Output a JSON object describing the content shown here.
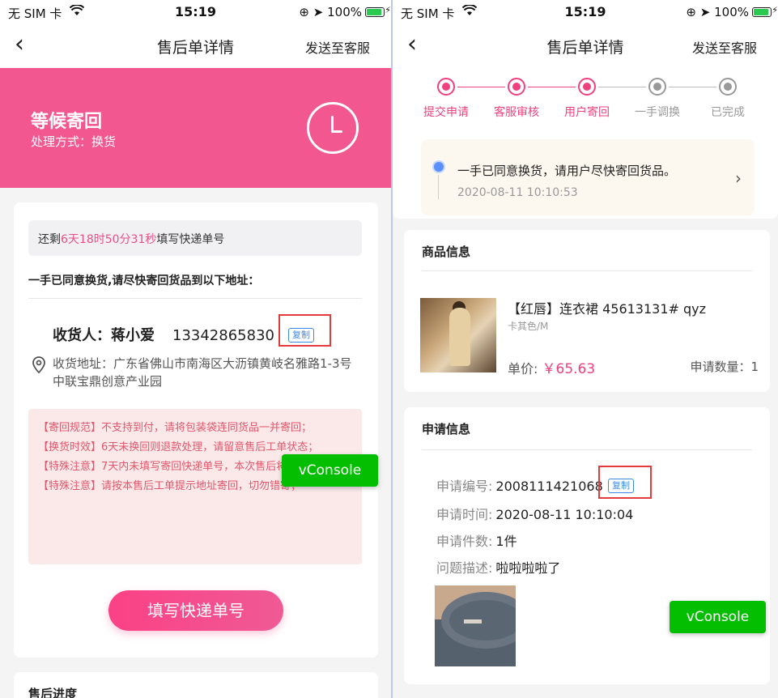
{
  "status_bar": {
    "carrier": "无 SIM 卡",
    "time": "15:19",
    "battery": "100%"
  },
  "nav": {
    "title": "售后单详情",
    "action": "发送至客服"
  },
  "left": {
    "header": {
      "status": "等候寄回",
      "method": "处理方式：换货"
    },
    "countdown": {
      "prefix": "还剩",
      "time": "6天18时50分31秒",
      "suffix": "填写快递单号"
    },
    "agree_text": "一手已同意换货,请尽快寄回货品到以下地址：",
    "receiver": {
      "label": "收货人：蒋小爱",
      "phone": "13342865830",
      "copy": "复制"
    },
    "address": "收货地址：广东省佛山市南海区大沥镇黄岐名雅路1-3号中联宝鼎创意产业园",
    "notices": [
      "【寄回规范】不支持到付，请将包装袋连同货品一并寄回；",
      "【换货时效】6天未换回则退款处理，请留意售后工单状态；",
      "【特殊注意】7天内未填写寄回快递单号，本次售后将自动关闭；",
      "【特殊注意】请按本售后工单提示地址寄回，切勿错寄；"
    ],
    "submit_button": "填写快递单号",
    "vconsole": "vConsole",
    "next_section_title": "售后进度"
  },
  "right": {
    "steps": [
      {
        "label": "提交申请",
        "done": true
      },
      {
        "label": "客服审核",
        "done": true
      },
      {
        "label": "用户寄回",
        "done": true
      },
      {
        "label": "一手调换",
        "done": false
      },
      {
        "label": "已完成",
        "done": false
      }
    ],
    "progress": {
      "message": "一手已同意换货，请用户尽快寄回货品。",
      "time": "2020-08-11 10:10:53"
    },
    "goods": {
      "section_title": "商品信息",
      "name": "【红唇】连衣裙 45613131# qyz",
      "spec": "卡其色/M",
      "price_label": "单价:",
      "price": "￥65.63",
      "qty": "申请数量：1"
    },
    "apply": {
      "section_title": "申请信息",
      "fields": [
        {
          "k": "申请编号:",
          "v": "2008111421068"
        },
        {
          "k": "申请时间:",
          "v": "2020-08-11 10:10:04"
        },
        {
          "k": "申请件数:",
          "v": "1件"
        },
        {
          "k": "问题描述:",
          "v": "啦啦啦啦了"
        }
      ],
      "copy": "复制"
    },
    "vconsole": "vConsole"
  },
  "colors": {
    "primary": "#f2578f",
    "accent": "#f0417f",
    "vconsole": "#04be02",
    "link": "#3a8be8"
  }
}
